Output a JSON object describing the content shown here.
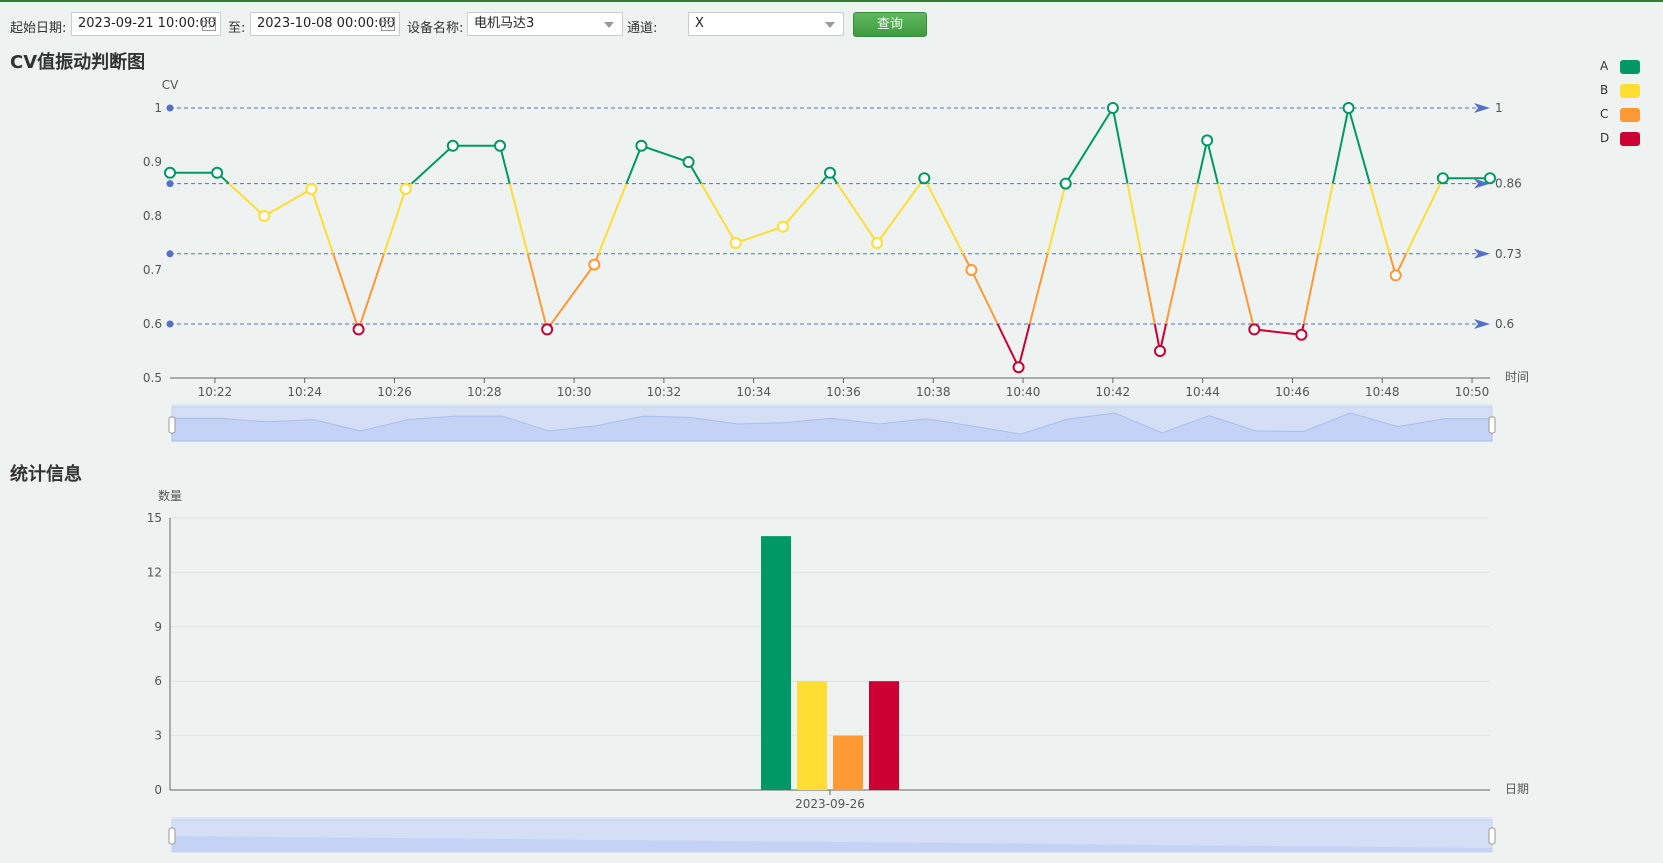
{
  "toolbar": {
    "start_label": "起始日期:",
    "start_value": "2023-09-21 10:00:00",
    "to_label": "至:",
    "end_value": "2023-10-08 00:00:00",
    "device_label": "设备名称:",
    "device_value": "电机马达3",
    "channel_label": "通道:",
    "channel_value": "X",
    "query_label": "查询"
  },
  "sections": {
    "cv_title": "CV值振动判断图",
    "stats_title": "统计信息"
  },
  "legend": [
    {
      "name": "A",
      "color": "#009966"
    },
    {
      "name": "B",
      "color": "#ffde33"
    },
    {
      "name": "C",
      "color": "#ff9933"
    },
    {
      "name": "D",
      "color": "#cc0033"
    }
  ],
  "chart_data": [
    {
      "type": "line",
      "ylabel": "CV",
      "xlabel": "时间",
      "ylim": [
        0.5,
        1
      ],
      "yticks": [
        "0.5",
        "0.6",
        "0.7",
        "0.8",
        "0.9",
        "1"
      ],
      "xticks": [
        "10:22",
        "10:24",
        "10:26",
        "10:28",
        "10:30",
        "10:32",
        "10:34",
        "10:36",
        "10:38",
        "10:40",
        "10:42",
        "10:44",
        "10:46",
        "10:48",
        "10:50"
      ],
      "threshold_lines": [
        {
          "value": 1,
          "label": "1"
        },
        {
          "value": 0.86,
          "label": "0.86"
        },
        {
          "value": 0.73,
          "label": "0.73"
        },
        {
          "value": 0.6,
          "label": "0.6"
        }
      ],
      "x_minutes": [
        0,
        1.05,
        2.1,
        3.15,
        4.2,
        5.25,
        6.3,
        7.35,
        8.4,
        9.45,
        10.5,
        11.55,
        12.6,
        13.65,
        14.7,
        15.75,
        16.8,
        17.85,
        18.9,
        19.95,
        21,
        22.05,
        23.1,
        24.15,
        25.2,
        26.25,
        27.3,
        28.35,
        29.4
      ],
      "x_labels_note": "minutes after 10:21",
      "values": [
        0.88,
        0.88,
        0.8,
        0.85,
        0.59,
        0.85,
        0.93,
        0.93,
        0.59,
        0.71,
        0.93,
        0.9,
        0.75,
        0.78,
        0.88,
        0.75,
        0.87,
        0.7,
        0.52,
        0.86,
        1.0,
        0.55,
        0.94,
        0.59,
        0.58,
        1.0,
        0.69,
        0.87,
        0.87
      ],
      "band_colors": {
        "A": "#009966",
        "B": "#ffde33",
        "C": "#ff9933",
        "D": "#cc0033"
      },
      "grid": false
    },
    {
      "type": "bar",
      "ylabel": "数量",
      "xlabel": "日期",
      "ylim": [
        0,
        15
      ],
      "yticks": [
        "0",
        "3",
        "6",
        "9",
        "12",
        "15"
      ],
      "categories": [
        "2023-09-26"
      ],
      "series": [
        {
          "name": "A",
          "values": [
            14
          ],
          "color": "#009966"
        },
        {
          "name": "B",
          "values": [
            6
          ],
          "color": "#ffde33"
        },
        {
          "name": "C",
          "values": [
            3
          ],
          "color": "#ff9933"
        },
        {
          "name": "D",
          "values": [
            6
          ],
          "color": "#cc0033"
        }
      ],
      "grid": true
    }
  ]
}
